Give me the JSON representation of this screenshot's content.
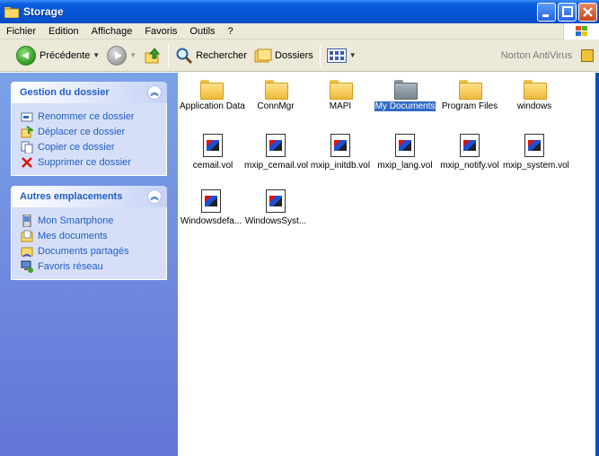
{
  "window": {
    "title": "Storage",
    "buttons": [
      "minimize",
      "maximize",
      "close"
    ]
  },
  "menu": [
    "Fichier",
    "Edition",
    "Affichage",
    "Favoris",
    "Outils",
    "?"
  ],
  "toolbar": {
    "back_label": "Précédente",
    "search_label": "Rechercher",
    "folders_label": "Dossiers",
    "norton_label": "Norton AntiVirus"
  },
  "sidebar": {
    "folder_tasks": {
      "title": "Gestion du dossier",
      "items": [
        {
          "label": "Renommer ce dossier",
          "icon": "rename-icon"
        },
        {
          "label": "Déplacer ce dossier",
          "icon": "move-icon"
        },
        {
          "label": "Copier ce dossier",
          "icon": "copy-icon"
        },
        {
          "label": "Supprimer ce dossier",
          "icon": "delete-icon"
        }
      ]
    },
    "other_places": {
      "title": "Autres emplacements",
      "items": [
        {
          "label": "Mon Smartphone",
          "icon": "smartphone-icon"
        },
        {
          "label": "Mes documents",
          "icon": "documents-icon"
        },
        {
          "label": "Documents partagés",
          "icon": "shared-folder-icon"
        },
        {
          "label": "Favoris réseau",
          "icon": "network-icon"
        }
      ]
    }
  },
  "files": [
    {
      "name": "Application Data",
      "type": "folder"
    },
    {
      "name": "ConnMgr",
      "type": "folder"
    },
    {
      "name": "MAPI",
      "type": "folder"
    },
    {
      "name": "My Documents",
      "type": "folder-special",
      "selected": true
    },
    {
      "name": "Program Files",
      "type": "folder"
    },
    {
      "name": "windows",
      "type": "folder"
    },
    {
      "name": "cemail.vol",
      "type": "vol"
    },
    {
      "name": "mxip_cemail.vol",
      "type": "vol"
    },
    {
      "name": "mxip_initdb.vol",
      "type": "vol"
    },
    {
      "name": "mxip_lang.vol",
      "type": "vol"
    },
    {
      "name": "mxip_notify.vol",
      "type": "vol"
    },
    {
      "name": "mxip_system.vol",
      "type": "vol"
    },
    {
      "name": "Windowsdefa...",
      "type": "vol"
    },
    {
      "name": "WindowsSyst...",
      "type": "vol"
    }
  ],
  "colors": {
    "titlebar": "#0453d6",
    "sidebar": "#6f8fe0",
    "link": "#215dc6",
    "selection": "#316ac5"
  }
}
